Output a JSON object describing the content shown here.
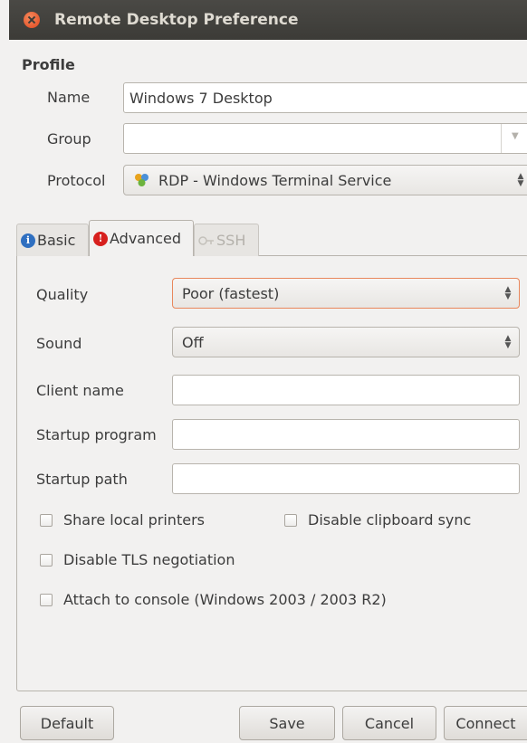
{
  "window": {
    "title": "Remote Desktop Preference"
  },
  "profile": {
    "heading": "Profile",
    "name_label": "Name",
    "name_value": "Windows 7 Desktop",
    "group_label": "Group",
    "group_value": "",
    "protocol_label": "Protocol",
    "protocol_value": "RDP - Windows Terminal Service"
  },
  "tabs": [
    {
      "label": "Basic",
      "icon": "info-icon",
      "state": "inactive"
    },
    {
      "label": "Advanced",
      "icon": "warning-icon",
      "state": "active"
    },
    {
      "label": "SSH",
      "icon": "ssh-key-icon",
      "state": "disabled"
    }
  ],
  "advanced": {
    "quality_label": "Quality",
    "quality_value": "Poor (fastest)",
    "sound_label": "Sound",
    "sound_value": "Off",
    "client_name_label": "Client name",
    "client_name_value": "",
    "startup_program_label": "Startup program",
    "startup_program_value": "",
    "startup_path_label": "Startup path",
    "startup_path_value": "",
    "checkboxes": [
      {
        "label": "Share local printers",
        "checked": false
      },
      {
        "label": "Disable clipboard sync",
        "checked": false
      },
      {
        "label": "Disable TLS negotiation",
        "checked": false
      },
      {
        "label": "Attach to console (Windows 2003 / 2003 R2)",
        "checked": false
      }
    ]
  },
  "buttons": {
    "default": "Default",
    "save": "Save",
    "cancel": "Cancel",
    "connect": "Connect"
  },
  "colors": {
    "titlebar": "#3c3b37",
    "close_button": "#e0461d",
    "focus_border": "#e8875c",
    "info_icon": "#2f6fc0",
    "warning_icon": "#d7201e"
  }
}
